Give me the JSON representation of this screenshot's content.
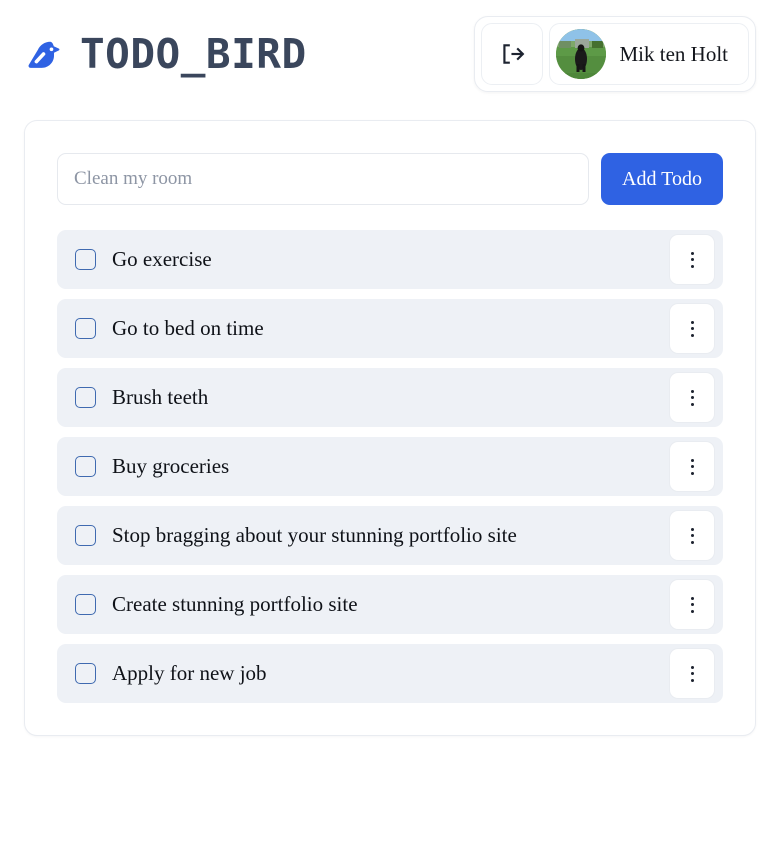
{
  "app": {
    "title": "TODO_BIRD",
    "logo_icon": "bird-icon",
    "brand_color": "#2f62e3",
    "title_color": "#3a465c"
  },
  "header": {
    "logout_button": {
      "icon": "logout-icon",
      "label": ""
    },
    "user": {
      "name": "Mik ten Holt",
      "avatar_alt": "black-dog-in-green-field-photo"
    }
  },
  "compose": {
    "input_placeholder": "Clean my room",
    "input_value": "",
    "add_button_label": "Add Todo",
    "add_button_color": "#2f62e3"
  },
  "todos": [
    {
      "text": "Go exercise",
      "checked": false,
      "menu_icon": "kebab-menu-icon"
    },
    {
      "text": "Go to bed on time",
      "checked": false,
      "menu_icon": "kebab-menu-icon"
    },
    {
      "text": "Brush teeth",
      "checked": false,
      "menu_icon": "kebab-menu-icon"
    },
    {
      "text": "Buy groceries",
      "checked": false,
      "menu_icon": "kebab-menu-icon"
    },
    {
      "text": "Stop bragging about your stunning portfolio site",
      "checked": false,
      "menu_icon": "kebab-menu-icon"
    },
    {
      "text": "Create stunning portfolio site",
      "checked": false,
      "menu_icon": "kebab-menu-icon"
    },
    {
      "text": "Apply for new job",
      "checked": false,
      "menu_icon": "kebab-menu-icon"
    }
  ]
}
